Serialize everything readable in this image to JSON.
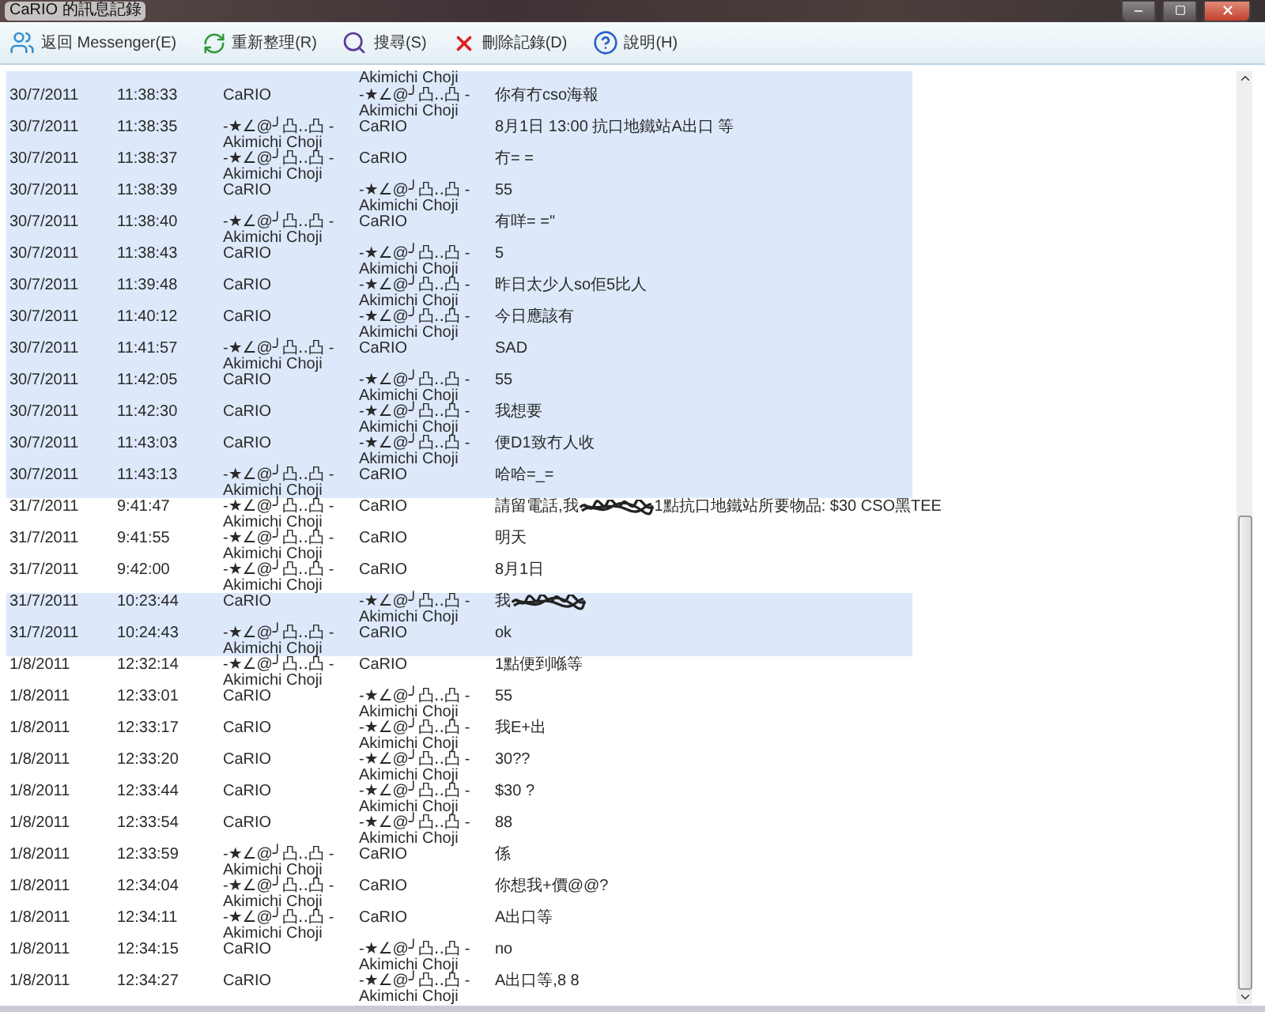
{
  "window": {
    "title": "CaRIO 的訊息記錄"
  },
  "toolbar": [
    {
      "label": "返回 Messenger(E)",
      "kind": "people"
    },
    {
      "label": "重新整理(R)",
      "kind": "refresh"
    },
    {
      "label": "搜尋(S)",
      "kind": "search"
    },
    {
      "label": "刪除記錄(D)",
      "kind": "delete"
    },
    {
      "label": "說明(H)",
      "kind": "help"
    }
  ],
  "log": {
    "top_partial": "Akimichi Choji",
    "top_partial_shaded": true,
    "rows": [
      {
        "date": "30/7/2011",
        "time": "11:38:33",
        "from": "CaRIO",
        "to": "-★∠@╯凸‥凸 -\nAkimichi Choji",
        "message": "你有冇cso海報",
        "shaded": true
      },
      {
        "date": "30/7/2011",
        "time": "11:38:35",
        "from": "-★∠@╯凸‥凸 -\nAkimichi Choji",
        "to": "CaRIO",
        "message": "8月1日 13:00 抗口地鐵站A出口 等",
        "shaded": true
      },
      {
        "date": "30/7/2011",
        "time": "11:38:37",
        "from": "-★∠@╯凸‥凸 -\nAkimichi Choji",
        "to": "CaRIO",
        "message": "冇= =",
        "shaded": true
      },
      {
        "date": "30/7/2011",
        "time": "11:38:39",
        "from": "CaRIO",
        "to": "-★∠@╯凸‥凸 -\nAkimichi Choji",
        "message": "55",
        "shaded": true
      },
      {
        "date": "30/7/2011",
        "time": "11:38:40",
        "from": "-★∠@╯凸‥凸 -\nAkimichi Choji",
        "to": "CaRIO",
        "message": "有咩= =\"",
        "shaded": true
      },
      {
        "date": "30/7/2011",
        "time": "11:38:43",
        "from": "CaRIO",
        "to": "-★∠@╯凸‥凸 -\nAkimichi Choji",
        "message": "5",
        "shaded": true
      },
      {
        "date": "30/7/2011",
        "time": "11:39:48",
        "from": "CaRIO",
        "to": "-★∠@╯凸‥凸 -\nAkimichi Choji",
        "message": "昨日太少人so佢5比人",
        "shaded": true
      },
      {
        "date": "30/7/2011",
        "time": "11:40:12",
        "from": "CaRIO",
        "to": "-★∠@╯凸‥凸 -\nAkimichi Choji",
        "message": "今日應該有",
        "shaded": true
      },
      {
        "date": "30/7/2011",
        "time": "11:41:57",
        "from": "-★∠@╯凸‥凸 -\nAkimichi Choji",
        "to": "CaRIO",
        "message": "SAD",
        "shaded": true
      },
      {
        "date": "30/7/2011",
        "time": "11:42:05",
        "from": "CaRIO",
        "to": "-★∠@╯凸‥凸 -\nAkimichi Choji",
        "message": "55",
        "shaded": true
      },
      {
        "date": "30/7/2011",
        "time": "11:42:30",
        "from": "CaRIO",
        "to": "-★∠@╯凸‥凸 -\nAkimichi Choji",
        "message": "我想要",
        "shaded": true
      },
      {
        "date": "30/7/2011",
        "time": "11:43:03",
        "from": "CaRIO",
        "to": "-★∠@╯凸‥凸 -\nAkimichi Choji",
        "message": "便D1致冇人收",
        "shaded": true
      },
      {
        "date": "30/7/2011",
        "time": "11:43:13",
        "from": "-★∠@╯凸‥凸 -\nAkimichi Choji",
        "to": "CaRIO",
        "message": "哈哈=_=",
        "shaded": true
      },
      {
        "date": "31/7/2011",
        "time": "9:41:47",
        "from": "-★∠@╯凸‥凸 -\nAkimichi Choji",
        "to": "CaRIO",
        "message": "請留電話,我",
        "redacted": true,
        "message_after": "1點抗口地鐵站所要物品: $30 CSO黑TEE",
        "shaded": false
      },
      {
        "date": "31/7/2011",
        "time": "9:41:55",
        "from": "-★∠@╯凸‥凸 -\nAkimichi Choji",
        "to": "CaRIO",
        "message": "明天",
        "shaded": false
      },
      {
        "date": "31/7/2011",
        "time": "9:42:00",
        "from": "-★∠@╯凸‥凸 -\nAkimichi Choji",
        "to": "CaRIO",
        "message": "8月1日",
        "shaded": false
      },
      {
        "date": "31/7/2011",
        "time": "10:23:44",
        "from": "CaRIO",
        "to": "-★∠@╯凸‥凸 -\nAkimichi Choji",
        "message": "我",
        "redacted": true,
        "shaded": true
      },
      {
        "date": "31/7/2011",
        "time": "10:24:43",
        "from": "-★∠@╯凸‥凸 -\nAkimichi Choji",
        "to": "CaRIO",
        "message": "ok",
        "shaded": true
      },
      {
        "date": "1/8/2011",
        "time": "12:32:14",
        "from": "-★∠@╯凸‥凸 -\nAkimichi Choji",
        "to": "CaRIO",
        "message": "1點便到喺等",
        "shaded": false
      },
      {
        "date": "1/8/2011",
        "time": "12:33:01",
        "from": "CaRIO",
        "to": "-★∠@╯凸‥凸 -\nAkimichi Choji",
        "message": "55",
        "shaded": false
      },
      {
        "date": "1/8/2011",
        "time": "12:33:17",
        "from": "CaRIO",
        "to": "-★∠@╯凸‥凸 -\nAkimichi Choji",
        "message": "我E+出",
        "shaded": false
      },
      {
        "date": "1/8/2011",
        "time": "12:33:20",
        "from": "CaRIO",
        "to": "-★∠@╯凸‥凸 -\nAkimichi Choji",
        "message": "30??",
        "shaded": false
      },
      {
        "date": "1/8/2011",
        "time": "12:33:44",
        "from": "CaRIO",
        "to": "-★∠@╯凸‥凸 -\nAkimichi Choji",
        "message": "$30 ?",
        "shaded": false
      },
      {
        "date": "1/8/2011",
        "time": "12:33:54",
        "from": "CaRIO",
        "to": "-★∠@╯凸‥凸 -\nAkimichi Choji",
        "message": "88",
        "shaded": false
      },
      {
        "date": "1/8/2011",
        "time": "12:33:59",
        "from": "-★∠@╯凸‥凸 -\nAkimichi Choji",
        "to": "CaRIO",
        "message": "係",
        "shaded": false
      },
      {
        "date": "1/8/2011",
        "time": "12:34:04",
        "from": "-★∠@╯凸‥凸 -\nAkimichi Choji",
        "to": "CaRIO",
        "message": "你想我+價@@?",
        "shaded": false
      },
      {
        "date": "1/8/2011",
        "time": "12:34:11",
        "from": "-★∠@╯凸‥凸 -\nAkimichi Choji",
        "to": "CaRIO",
        "message": "A出口等",
        "shaded": false
      },
      {
        "date": "1/8/2011",
        "time": "12:34:15",
        "from": "CaRIO",
        "to": "-★∠@╯凸‥凸 -\nAkimichi Choji",
        "message": "no",
        "shaded": false
      },
      {
        "date": "1/8/2011",
        "time": "12:34:27",
        "from": "CaRIO",
        "to": "-★∠@╯凸‥凸 -\nAkimichi Choji",
        "message": "A出口等,8 8",
        "shaded": false
      }
    ]
  }
}
